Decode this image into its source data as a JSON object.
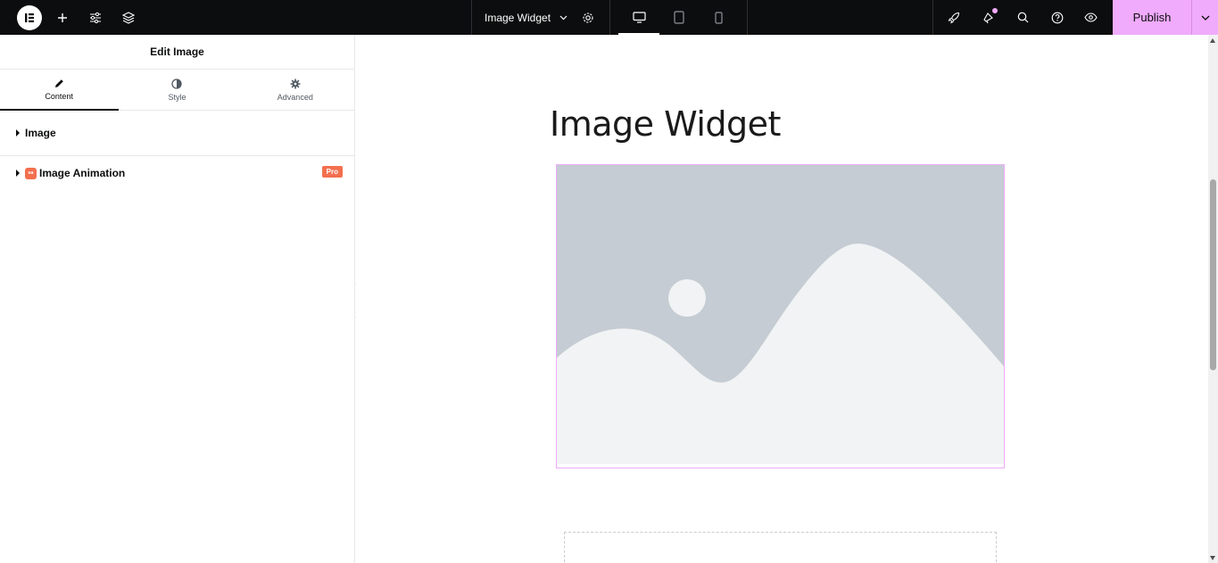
{
  "topbar": {
    "logo_icon": "elementor-logo-icon",
    "document_title": "Image Widget",
    "publish_label": "Publish",
    "accent_color": "#f0abfc"
  },
  "panel": {
    "title": "Edit Image",
    "tabs": [
      {
        "label": "Content",
        "icon": "pencil-icon"
      },
      {
        "label": "Style",
        "icon": "half-circle-icon"
      },
      {
        "label": "Advanced",
        "icon": "gear-icon"
      }
    ],
    "sections": [
      {
        "label": "Image"
      },
      {
        "label": "Image Animation",
        "badge": "Pro"
      }
    ]
  },
  "canvas": {
    "heading": "Image Widget"
  }
}
